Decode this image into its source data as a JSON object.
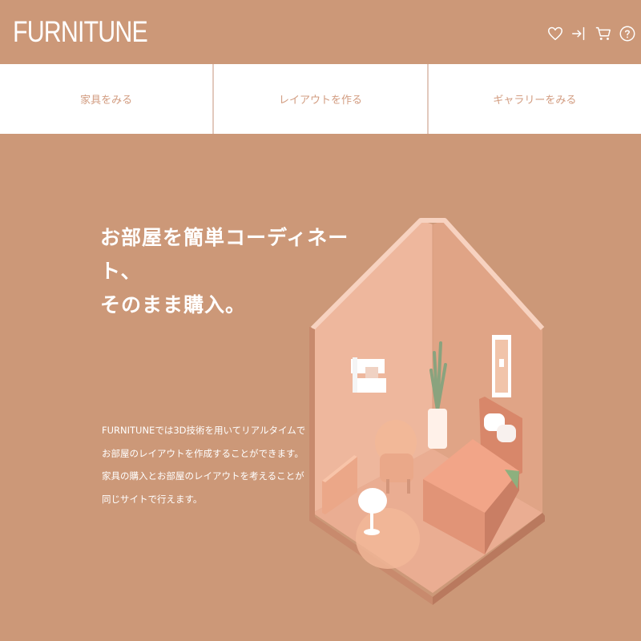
{
  "header": {
    "logo": "FURNITUNE",
    "icons": [
      "heart-icon",
      "login-icon",
      "cart-icon",
      "help-icon"
    ]
  },
  "nav": {
    "items": [
      {
        "label": "家具をみる"
      },
      {
        "label": "レイアウトを作る"
      },
      {
        "label": "ギャラリーをみる"
      }
    ]
  },
  "hero": {
    "title_line1": "お部屋を簡単コーディネート、",
    "title_line2": "そのまま購入。",
    "description": [
      "FURNITUNEでは3D技術を用いてリアルタイムで",
      "お部屋のレイアウトを作成することができます。",
      "家具の購入とお部屋のレイアウトを考えることが",
      "同じサイトで行えます。"
    ]
  },
  "colors": {
    "background": "#cc9878",
    "nav_background": "#ffffff",
    "nav_text": "#d29c80",
    "text": "#ffffff"
  }
}
